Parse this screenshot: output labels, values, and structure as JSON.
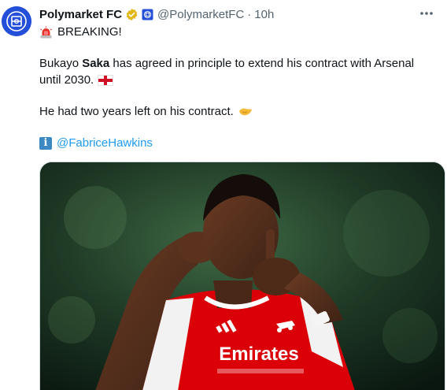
{
  "tweet": {
    "author_name": "Polymarket FC",
    "handle": "@PolymarketFC",
    "separator": "·",
    "time": "10h",
    "breaking_text": "BREAKING!",
    "body_line1_pre": "Bukayo ",
    "body_line1_bold": "Saka",
    "body_line1_post": " has agreed in principle to extend his contract with Arsenal",
    "body_line2": "until 2030.",
    "body_line3": "He had two years left on his contract.",
    "credit_handle": "@FabriceHawkins",
    "jersey_sponsor": "Emirates"
  },
  "icons": {
    "verified": "verified-badge-icon",
    "affiliate": "affiliate-badge-icon",
    "more": "more-icon",
    "siren": "siren-icon",
    "flag": "england-flag-icon",
    "handshake": "handshake-icon",
    "info": "info-icon"
  },
  "colors": {
    "link": "#1d9bf0",
    "verified_gold": "#e2b719",
    "secondary_text": "#536471",
    "arsenal_red": "#db0007"
  }
}
